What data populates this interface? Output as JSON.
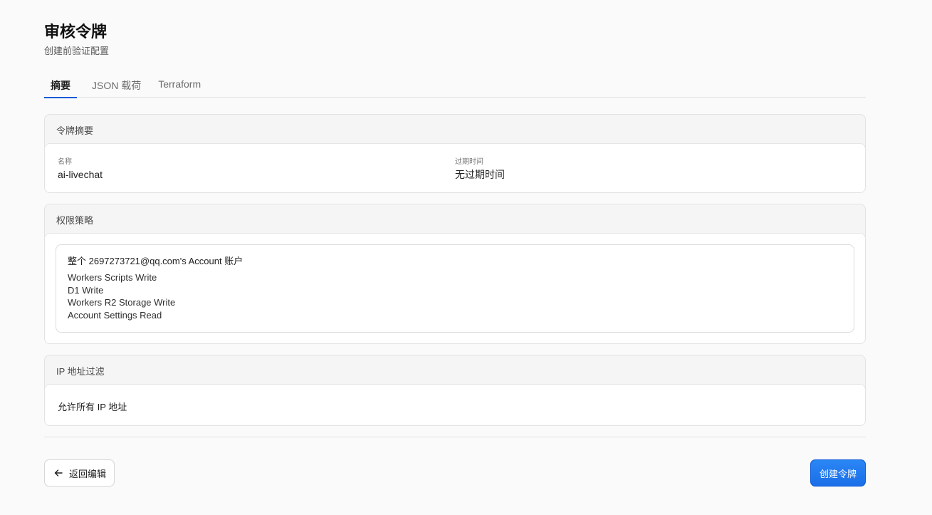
{
  "header": {
    "title": "审核令牌",
    "subtitle": "创建前验证配置"
  },
  "tabs": [
    {
      "label": "摘要",
      "active": true
    },
    {
      "label": "JSON 载荷",
      "active": false
    },
    {
      "label": "Terraform",
      "active": false
    }
  ],
  "summary": {
    "heading": "令牌摘要",
    "name_label": "名称",
    "name_value": "ai-livechat",
    "expiry_label": "过期时间",
    "expiry_value": "无过期时间"
  },
  "permissions": {
    "heading": "权限策略",
    "scope": "整个 2697273721@qq.com's Account 账户",
    "items": [
      "Workers Scripts Write",
      "D1 Write",
      "Workers R2 Storage Write",
      "Account Settings Read"
    ]
  },
  "ip_filter": {
    "heading": "IP 地址过滤",
    "value": "允许所有 IP 地址"
  },
  "footer": {
    "back_label": "返回编辑",
    "create_label": "创建令牌"
  },
  "colors": {
    "accent": "#1a6fe8",
    "tab_indicator": "#0a5ad8"
  }
}
